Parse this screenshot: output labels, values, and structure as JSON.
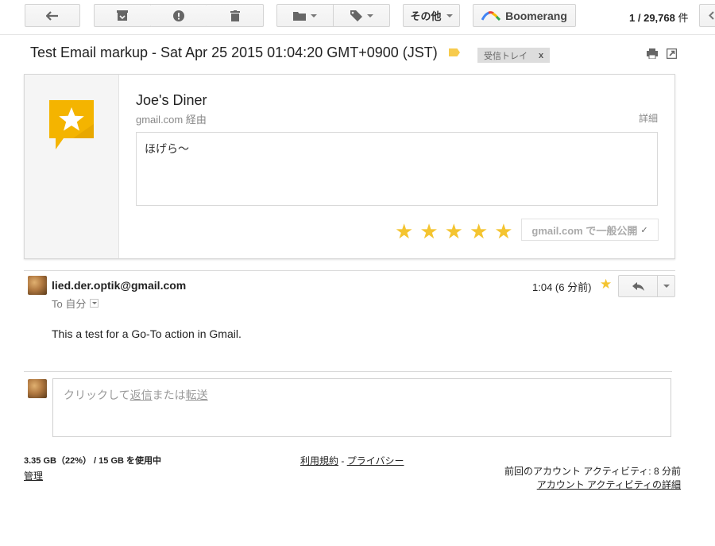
{
  "toolbar": {
    "back_icon": "arrow-left-icon",
    "archive_icon": "archive-icon",
    "spam_icon": "report-spam-icon",
    "delete_icon": "trash-icon",
    "move_icon": "folder-icon",
    "labels_icon": "label-icon",
    "more_label": "その他",
    "boomerang_label": "Boomerang",
    "counter_range": "1",
    "counter_total": "29,768",
    "counter_unit": "件"
  },
  "subject": {
    "title": "Test Email markup - Sat Apr 25 2015 01:04:20 GMT+0900 (JST)",
    "label": "受信トレイ",
    "label_remove": "x",
    "accent": "#f7cb4d"
  },
  "card": {
    "title": "Joe's Diner",
    "via": "gmail.com 経由",
    "details": "詳細",
    "body": "ほげら〜",
    "stars": [
      "★",
      "★",
      "★",
      "★",
      "★"
    ],
    "public_label": "gmail.com で一般公開",
    "public_check": "✓",
    "star_color": "#f4c430",
    "logo_color": "#f4b400"
  },
  "message": {
    "sender": "lied.der.optik@gmail.com",
    "to": "To 自分",
    "time": "1:04 (6 分前)",
    "body": "This a test for a Go-To action in Gmail."
  },
  "reply": {
    "prefix": "クリックして",
    "reply_link": "返信",
    "middle": "または",
    "forward_link": "転送"
  },
  "footer": {
    "storage": "3.35 GB（22%） / 15 GB を使用中",
    "manage": "管理",
    "terms": "利用規約",
    "separator": " - ",
    "privacy": "プライバシー",
    "activity": "前回のアカウント アクティビティ: 8 分前",
    "activity_details": "アカウント アクティビティの詳細"
  }
}
